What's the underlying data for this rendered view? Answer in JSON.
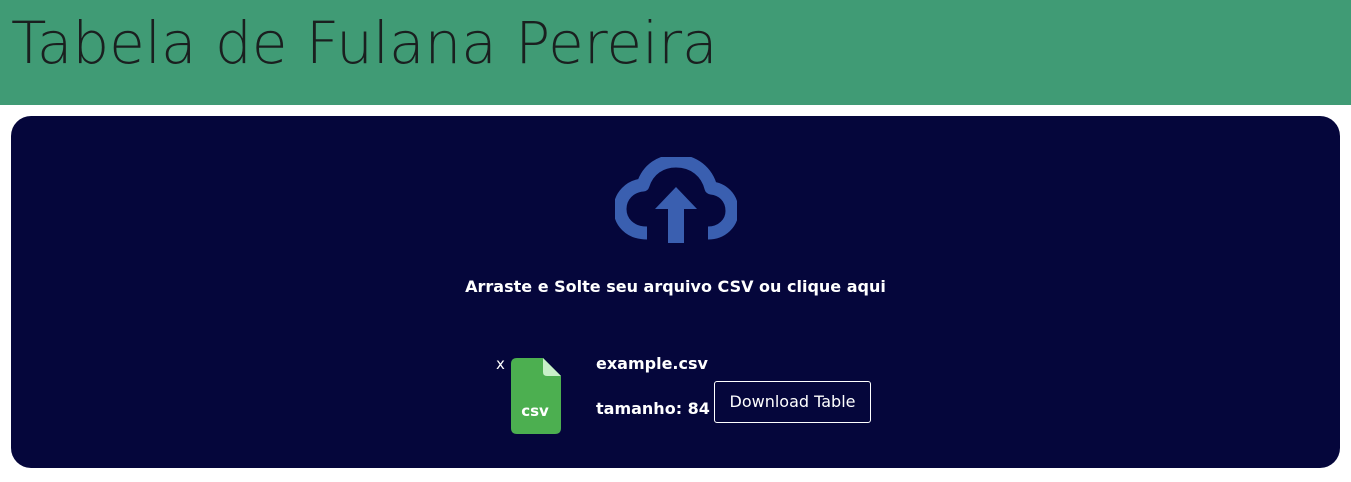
{
  "header": {
    "title": "Tabela de Fulana Pereira"
  },
  "dropzone": {
    "icon": "cloud-upload-icon",
    "label": "Arraste e Solte seu arquivo CSV ou clique aqui"
  },
  "file": {
    "remove_label": "x",
    "icon": "csv-file-icon",
    "icon_text": "csv",
    "name": "example.csv",
    "size_label": "tamanho:",
    "size_value": "84"
  },
  "actions": {
    "download_label": "Download Table"
  },
  "colors": {
    "header_bg": "#409b75",
    "dropzone_bg": "#05063b",
    "upload_icon": "#3a5fb0",
    "csv_green": "#4caf50",
    "csv_fold": "#c8f0c8"
  }
}
